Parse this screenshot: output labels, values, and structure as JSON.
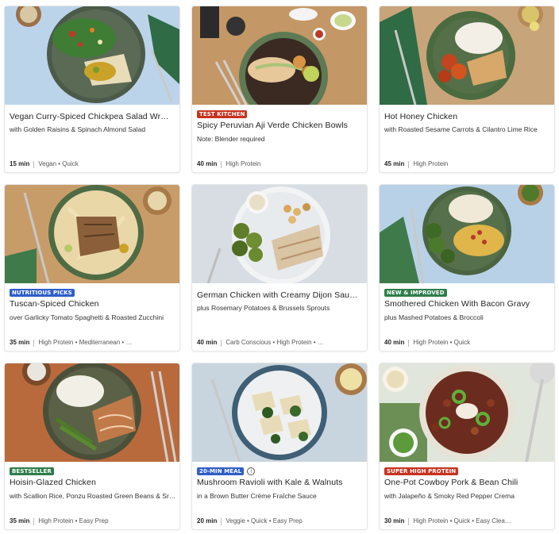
{
  "colors": {
    "badge_test_kitchen": "#c8321e",
    "badge_nutritious": "#2f5ec9",
    "badge_new_improved": "#2e7d4a",
    "badge_bestseller": "#2e7d4a",
    "badge_20min": "#2f5ec9",
    "badge_super_high_protein": "#c8321e"
  },
  "recipes": [
    {
      "title": "Vegan Curry-Spiced Chickpea Salad Wr…",
      "subtitle": "with Golden Raisins & Spinach Almond Salad",
      "time": "15 min",
      "tags": "Vegan • Quick",
      "badge": "",
      "badge_color": ""
    },
    {
      "title": "Spicy Peruvian Aji Verde Chicken Bowls",
      "subtitle": "Note: Blender required",
      "time": "40 min",
      "tags": "High Protein",
      "badge": "TEST KITCHEN",
      "badge_color": "#c8321e"
    },
    {
      "title": "Hot Honey Chicken",
      "subtitle": "with Roasted Sesame Carrots & Cilantro Lime Rice",
      "time": "45 min",
      "tags": "High Protein",
      "badge": "",
      "badge_color": ""
    },
    {
      "title": "Tuscan-Spiced Chicken",
      "subtitle": "over Garlicky Tomato Spaghetti & Roasted Zucchini",
      "time": "35 min",
      "tags": "High Protein • Mediterranean • …",
      "badge": "NUTRITIOUS PICKS",
      "badge_color": "#2f5ec9"
    },
    {
      "title": "German Chicken with Creamy Dijon Sau…",
      "subtitle": "plus Rosemary Potatoes & Brussels Sprouts",
      "time": "40 min",
      "tags": "Carb Conscious • High Protein • …",
      "badge": "",
      "badge_color": ""
    },
    {
      "title": "Smothered Chicken With Bacon Gravy",
      "subtitle": "plus Mashed Potatoes & Broccoli",
      "time": "40 min",
      "tags": "High Protein • Quick",
      "badge": "NEW & IMPROVED",
      "badge_color": "#2e7d4a"
    },
    {
      "title": "Hoisin-Glazed Chicken",
      "subtitle": "with Scallion Rice, Ponzu Roasted Green Beans & Sr…",
      "time": "35 min",
      "tags": "High Protein • Easy Prep",
      "badge": "BESTSELLER",
      "badge_color": "#2e7d4a"
    },
    {
      "title": "Mushroom Ravioli with Kale & Walnuts",
      "subtitle": "in a Brown Butter Crème Fraîche Sauce",
      "time": "20 min",
      "tags": "Veggie • Quick • Easy Prep",
      "badge": "20-MIN MEAL",
      "badge_color": "#2f5ec9",
      "info_icon": "i"
    },
    {
      "title": "One-Pot Cowboy Pork & Bean Chili",
      "subtitle": "with Jalapeño & Smoky Red Pepper Crema",
      "time": "30 min",
      "tags": "High Protein • Quick • Easy Clea…",
      "badge": "SUPER HIGH PROTEIN",
      "badge_color": "#c8321e"
    }
  ]
}
